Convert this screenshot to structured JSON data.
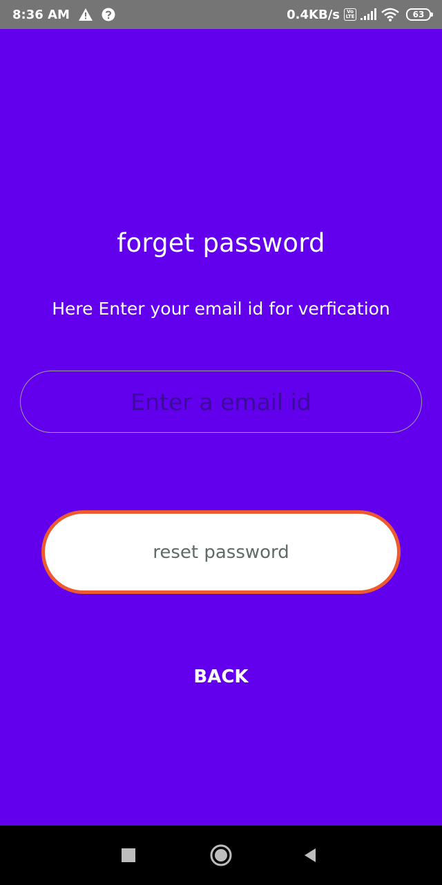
{
  "status_bar": {
    "time": "8:36 AM",
    "left_icons": [
      "warning-icon",
      "help-icon"
    ],
    "network_speed": "0.4KB/s",
    "volte_top": "Vo",
    "volte_bottom": "LTE",
    "battery_level": "63",
    "right_icons": [
      "volte-icon",
      "signal-icon",
      "wifi-icon",
      "battery-icon"
    ],
    "background_color": "#757575"
  },
  "main": {
    "title": "forget password",
    "subtitle": "Here Enter your email id for verfication",
    "email_input": {
      "value": "",
      "placeholder": "Enter a email id"
    },
    "reset_button_label": "reset password",
    "back_button_label": "BACK",
    "background_color": "#6200EE",
    "button_border_color": "#EE5A2F"
  },
  "nav_bar": {
    "buttons": [
      "recents-icon",
      "home-icon",
      "back-icon"
    ]
  }
}
